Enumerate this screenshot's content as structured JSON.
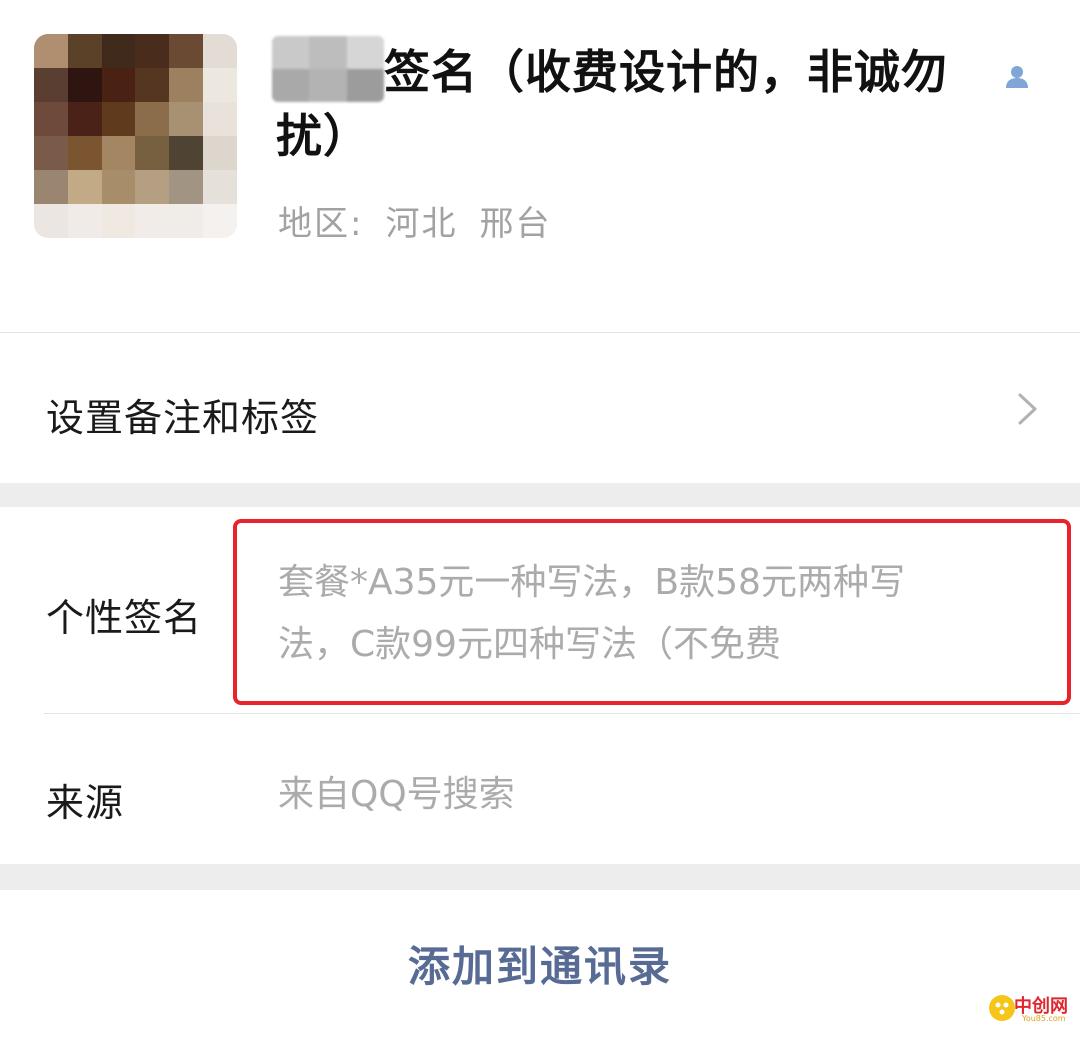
{
  "profile": {
    "nickname": "签名（收费设计的，非诚勿扰）",
    "region_label": "地区:",
    "region_province": "河北",
    "region_city": "邢台",
    "contact_icon": "person-icon",
    "avatar": "pixelated-avatar"
  },
  "remark_row": {
    "label": "设置备注和标签",
    "icon": "chevron-right-icon"
  },
  "signature_row": {
    "label": "个性签名",
    "value_line1": "套餐*A35元一种写法，B款58元两种写",
    "value_line2": "法，C款99元四种写法（不免费"
  },
  "source_row": {
    "label": "来源",
    "value": "来自QQ号搜索"
  },
  "add_button": {
    "label": "添加到通讯录"
  },
  "watermark": {
    "main": "中创网",
    "sub": "You85.com"
  },
  "colors": {
    "accent_link": "#576b95",
    "highlight_border": "#e8232b",
    "secondary_text": "#a2a2a2",
    "band_gray": "#ededed"
  }
}
